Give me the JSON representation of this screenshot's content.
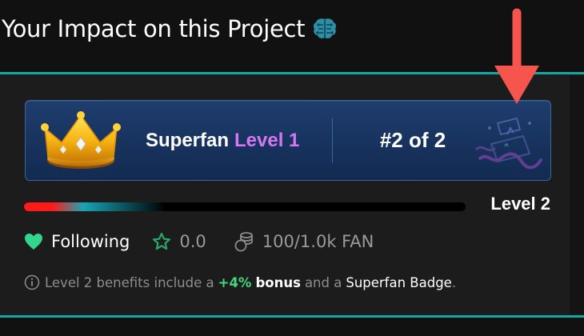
{
  "header": {
    "title": "Your Impact on this Project",
    "title_icon": "brain-icon"
  },
  "colors": {
    "accent_teal": "#14a8a3",
    "level_purple": "#d577f0",
    "bonus_green": "#46d67c",
    "follow_green": "#32d68a",
    "arrow_red": "#f5554d",
    "card_blue": "#1b3766"
  },
  "tier_card": {
    "crown_icon": "crown-icon",
    "tier_name": "Superfan",
    "tier_level": "Level 1",
    "rank": "#2 of 2",
    "reward_icon": "mystery-box-icon"
  },
  "progress": {
    "next_level_label": "Level 2",
    "fill_fraction": 0.32
  },
  "stats": {
    "following_label": "Following",
    "following_icon": "heart-icon",
    "rating_value": "0.0",
    "rating_icon": "star-icon",
    "fan_value": "100/1.0k FAN",
    "fan_icon": "coins-icon"
  },
  "benefits": {
    "info_icon": "info-icon",
    "prefix": "Level 2 benefits include a",
    "bonus_percent": "+4%",
    "bonus_word": "bonus",
    "middle": "and a",
    "badge_name": "Superfan Badge",
    "suffix": "."
  }
}
